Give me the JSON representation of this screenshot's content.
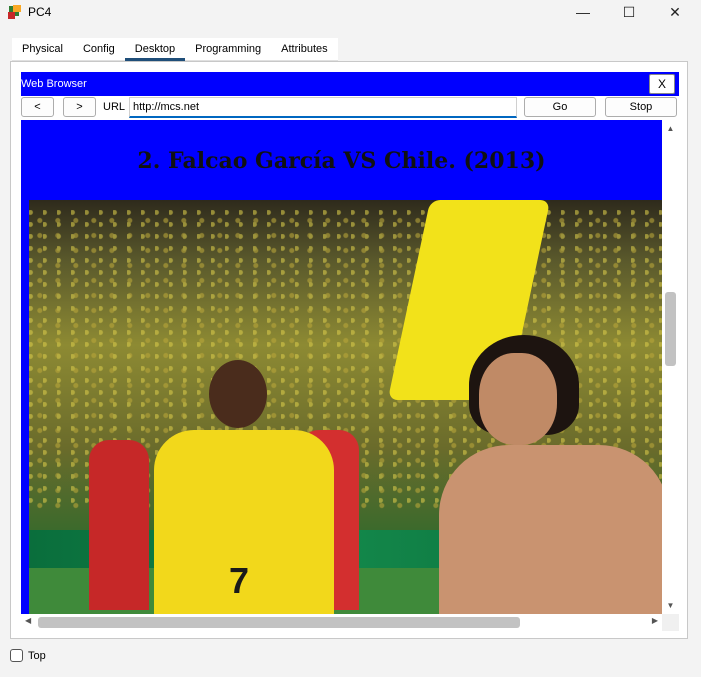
{
  "window": {
    "title": "PC4",
    "icon": "packet-tracer-pc-icon",
    "controls": {
      "minimize": "—",
      "maximize": "☐",
      "close": "✕"
    }
  },
  "tabs": [
    {
      "label": "Physical",
      "active": false
    },
    {
      "label": "Config",
      "active": false
    },
    {
      "label": "Desktop",
      "active": true
    },
    {
      "label": "Programming",
      "active": false
    },
    {
      "label": "Attributes",
      "active": false
    }
  ],
  "browser": {
    "title": "Web Browser",
    "close_label": "X",
    "back_label": "<",
    "forward_label": ">",
    "url_label": "URL",
    "url_value": "http://mcs.net",
    "go_label": "Go",
    "stop_label": "Stop"
  },
  "page": {
    "headline": "2. Falcao García VS Chile. (2013)",
    "image": "football-players-celebration-photo",
    "player_number": "7"
  },
  "footer": {
    "top_label": "Top",
    "top_checked": false
  },
  "colors": {
    "browser_blue": "#0000ff",
    "active_tab_underline": "#1f4e79"
  }
}
